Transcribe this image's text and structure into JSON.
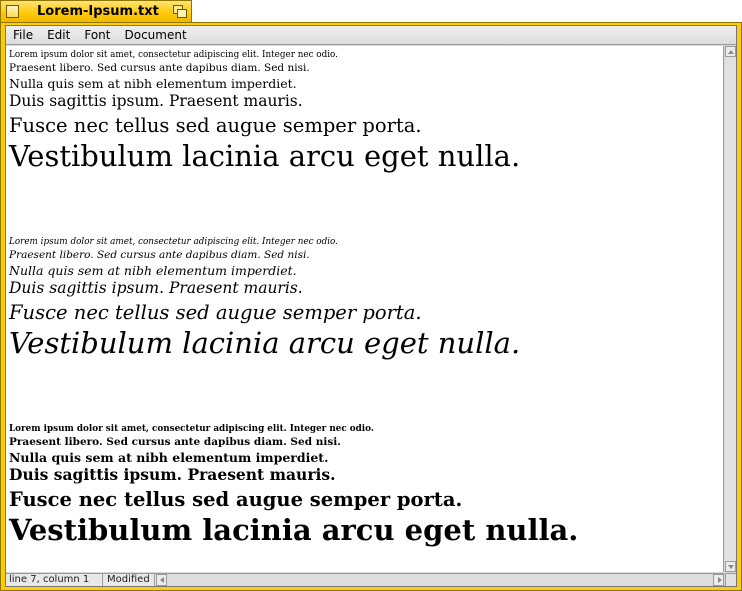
{
  "window": {
    "title": "Lorem-Ipsum.txt"
  },
  "menubar": {
    "items": [
      "File",
      "Edit",
      "Font",
      "Document"
    ]
  },
  "document": {
    "paragraph_groups": [
      {
        "style": "regular",
        "lines": [
          "Lorem ipsum dolor sit amet, consectetur adipiscing elit. Integer nec odio.",
          "Praesent libero. Sed cursus ante dapibus diam. Sed nisi.",
          "Nulla quis sem at nibh elementum imperdiet.",
          "Duis sagittis ipsum. Praesent mauris.",
          "Fusce nec tellus sed augue semper porta.",
          "Vestibulum lacinia arcu eget nulla."
        ]
      },
      {
        "style": "italic",
        "lines": [
          "Lorem ipsum dolor sit amet, consectetur adipiscing elit. Integer nec odio.",
          "Praesent libero. Sed cursus ante dapibus diam. Sed nisi.",
          "Nulla quis sem at nibh elementum imperdiet.",
          "Duis sagittis ipsum. Praesent mauris.",
          "Fusce nec tellus sed augue semper porta.",
          "Vestibulum lacinia arcu eget nulla."
        ]
      },
      {
        "style": "bold",
        "lines": [
          "Lorem ipsum dolor sit amet, consectetur adipiscing elit. Integer nec odio.",
          "Praesent libero. Sed cursus ante dapibus diam. Sed nisi.",
          "Nulla quis sem at nibh elementum imperdiet.",
          "Duis sagittis ipsum. Praesent mauris.",
          "Fusce nec tellus sed augue semper porta.",
          "Vestibulum lacinia arcu eget nulla."
        ]
      }
    ]
  },
  "statusbar": {
    "position": "line 7, column 1",
    "state": "Modified"
  },
  "colors": {
    "title_tab": "#ffcb08",
    "chrome": "#d8d8d8",
    "text": "#000000"
  }
}
